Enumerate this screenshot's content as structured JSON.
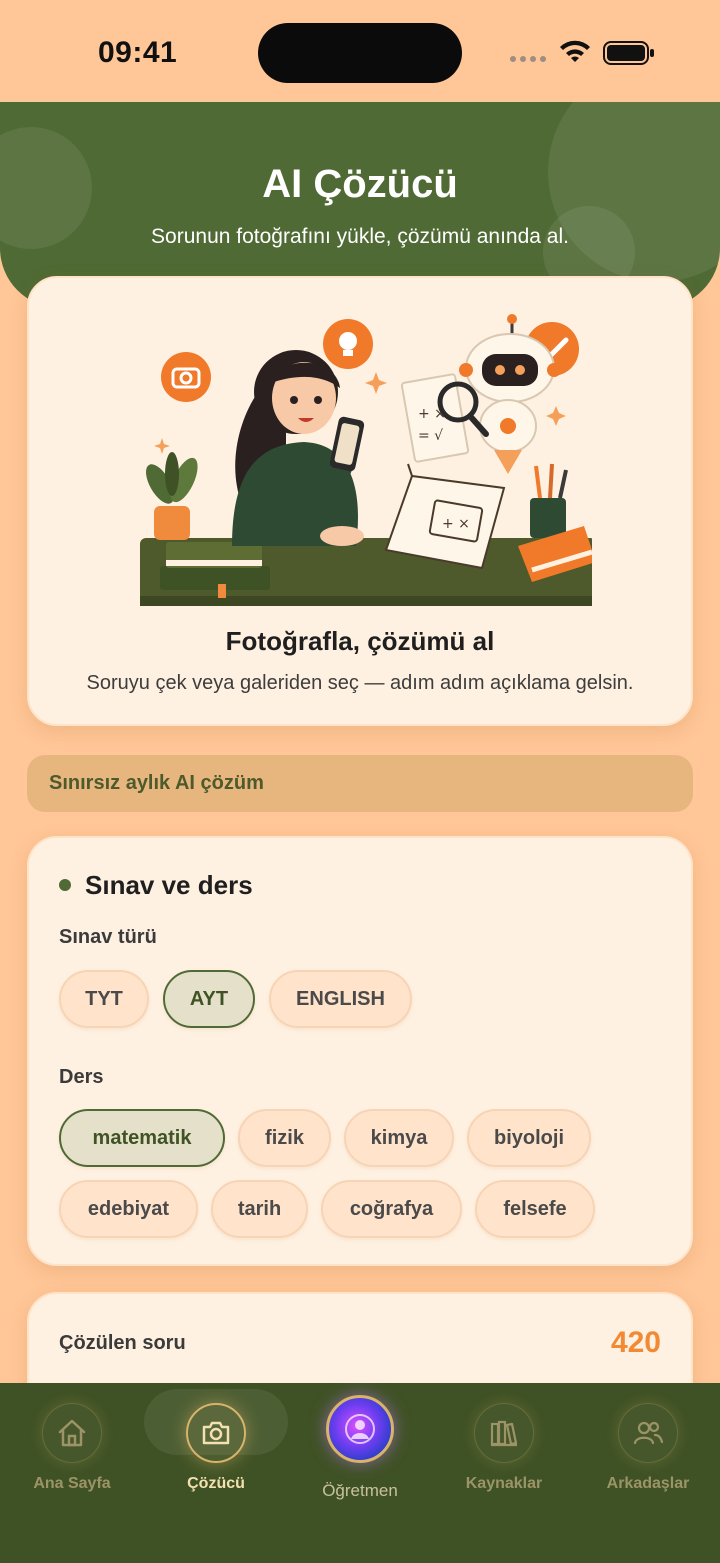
{
  "status_bar": {
    "time": "09:41"
  },
  "hero": {
    "title": "AI Çözücü",
    "subtitle": "Sorunun fotoğrafını yükle, çözümü anında al."
  },
  "illustration_card": {
    "title": "Fotoğrafla, çözümü al",
    "subtitle": "Soruyu çek veya galeriden seç — adım adım açıklama gelsin."
  },
  "promo": {
    "text": "Sınırsız aylık AI çözüm"
  },
  "exam_section": {
    "title": "Sınav ve ders",
    "exam_type_label": "Sınav türü",
    "exam_types": [
      {
        "label": "TYT",
        "selected": false
      },
      {
        "label": "AYT",
        "selected": true
      },
      {
        "label": "ENGLISH",
        "selected": false
      }
    ],
    "subject_label": "Ders",
    "subjects": [
      {
        "label": "matematik",
        "selected": true
      },
      {
        "label": "fizik",
        "selected": false
      },
      {
        "label": "kimya",
        "selected": false
      },
      {
        "label": "biyoloji",
        "selected": false
      },
      {
        "label": "edebiyat",
        "selected": false
      },
      {
        "label": "tarih",
        "selected": false
      },
      {
        "label": "coğrafya",
        "selected": false
      },
      {
        "label": "felsefe",
        "selected": false
      }
    ]
  },
  "stats": {
    "label": "Çözülen soru",
    "value": "420"
  },
  "nav": {
    "items": [
      {
        "label": "Ana Sayfa",
        "icon": "home-icon",
        "active": false
      },
      {
        "label": "Çözücü",
        "icon": "camera-icon",
        "active": true
      },
      {
        "label": "Öğretmen",
        "icon": "ai-teacher-orb-icon",
        "active": false
      },
      {
        "label": "Kaynaklar",
        "icon": "books-icon",
        "active": false
      },
      {
        "label": "Arkadaşlar",
        "icon": "friends-icon",
        "active": false
      }
    ]
  },
  "colors": {
    "background": "#FFC697",
    "hero_green": "#4F6A34",
    "nav_green": "#3F5225",
    "accent_orange": "#F28A35",
    "card": "#FFF1E1"
  }
}
